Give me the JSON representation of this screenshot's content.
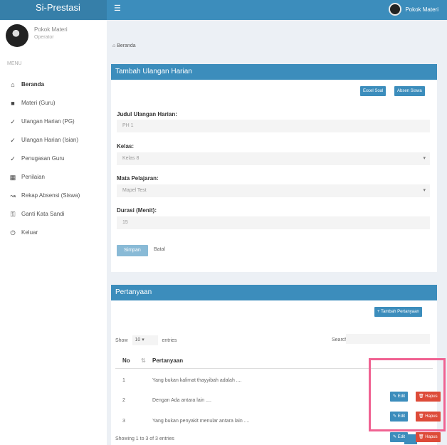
{
  "app": {
    "brand": "Si-Prestasi",
    "menu_icon": "bars-icon"
  },
  "topbar": {
    "user_name": "Pokok Materi"
  },
  "sidebar": {
    "user_name": "Pokok Materi",
    "user_status": "Operator",
    "menu_header": "MENU",
    "items": [
      {
        "label": "Beranda",
        "icon": "home-icon"
      },
      {
        "label": "Materi (Guru)",
        "icon": "folder-icon"
      },
      {
        "label": "Ulangan Harian (PG)",
        "icon": "check-icon"
      },
      {
        "label": "Ulangan Harian (Isian)",
        "icon": "check-icon"
      },
      {
        "label": "Penugasan Guru",
        "icon": "check-icon"
      },
      {
        "label": "Penilaian",
        "icon": "calendar-icon"
      },
      {
        "label": "Rekap Absensi (Siswa)",
        "icon": "chart-icon"
      },
      {
        "label": "Ganti Kata Sandi",
        "icon": "key-icon"
      },
      {
        "label": "Keluar",
        "icon": "power-icon"
      }
    ]
  },
  "breadcrumb": "Beranda",
  "form": {
    "header": "Tambah Ulangan Harian",
    "btn_import": "Excel Soal",
    "btn_siswa": "Absen Siswa",
    "judul_label": "Judul Ulangan Harian:",
    "judul_value": "PH 1",
    "kelas_label": "Kelas:",
    "kelas_value": "Kelas 8",
    "mapel_label": "Mata Pelajaran:",
    "mapel_value": "Mapel Test",
    "durasi_label": "Durasi (Menit):",
    "durasi_value": "15",
    "submit_label": "Simpan",
    "back_label": "Batal"
  },
  "questions": {
    "header": "Pertanyaan",
    "add_button": "+ Tambah Pertanyaan",
    "show_label": "Show",
    "entries_value": "10",
    "entries_label": "entries",
    "search_label": "Search:",
    "col_no": "No",
    "col_question": "Pertanyaan",
    "rows": [
      {
        "no": "1",
        "text": "Yang bukan kalimat thayyibah adalah ...."
      },
      {
        "no": "2",
        "text": "Dengan Ada antara lain ...."
      },
      {
        "no": "3",
        "text": "Yang bukan penyakit menular antara lain ...."
      }
    ],
    "edit_label": "Edit",
    "delete_label": "Hapus",
    "footer_text": "Showing 1 to 3 of 3 entries"
  }
}
